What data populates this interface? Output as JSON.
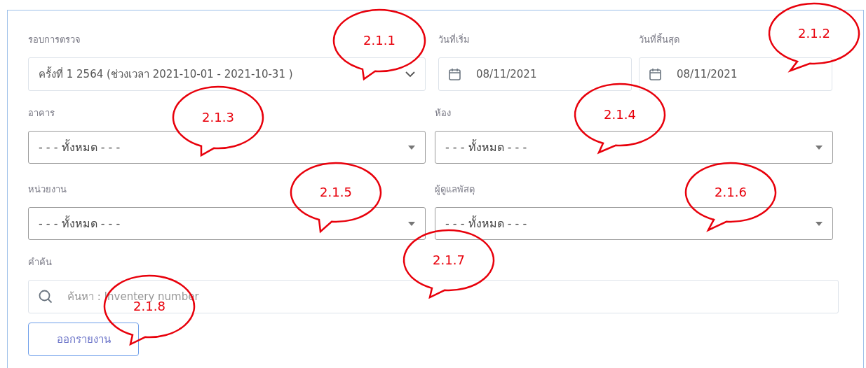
{
  "form": {
    "period": {
      "label": "รอบการตรวจ",
      "value": "ครั้งที่ 1 2564 (ช่วงเวลา 2021-10-01 - 2021-10-31 )"
    },
    "start_date": {
      "label": "วันที่เริ่ม",
      "value": "08/11/2021"
    },
    "end_date": {
      "label": "วันที่สิ้นสุด",
      "value": "08/11/2021"
    },
    "building": {
      "label": "อาคาร",
      "value": "- - - ทั้งหมด - - -"
    },
    "room": {
      "label": "ห้อง",
      "value": "- - - ทั้งหมด - - -"
    },
    "department": {
      "label": "หน่วยงาน",
      "value": "- - - ทั้งหมด - - -"
    },
    "custodian": {
      "label": "ผู้ดูแลพัสดุ",
      "value": "- - - ทั้งหมด - - -"
    },
    "search": {
      "label": "คำค้น",
      "placeholder": "ค้นหา : Inventery number"
    },
    "report_button": "ออกรายงาน"
  },
  "callouts": [
    {
      "label": "2.1.1"
    },
    {
      "label": "2.1.2"
    },
    {
      "label": "2.1.3"
    },
    {
      "label": "2.1.4"
    },
    {
      "label": "2.1.5"
    },
    {
      "label": "2.1.6"
    },
    {
      "label": "2.1.7"
    },
    {
      "label": "2.1.8"
    }
  ]
}
